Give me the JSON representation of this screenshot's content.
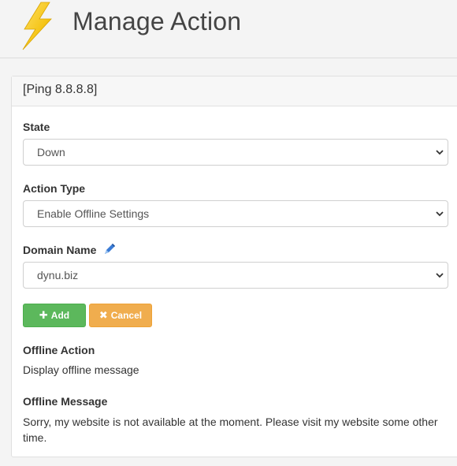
{
  "header": {
    "title": "Manage Action",
    "logo_icon": "lightning-bolt-icon"
  },
  "panel": {
    "heading": "[Ping 8.8.8.8]"
  },
  "form": {
    "state": {
      "label": "State",
      "value": "Down"
    },
    "action_type": {
      "label": "Action Type",
      "value": "Enable Offline Settings"
    },
    "domain_name": {
      "label": "Domain Name",
      "value": "dynu.biz",
      "edit_icon": "pencil-icon"
    }
  },
  "buttons": {
    "add_label": "Add",
    "add_icon": "plus-icon",
    "cancel_label": "Cancel",
    "cancel_icon": "times-icon"
  },
  "offline_action": {
    "label": "Offline Action",
    "value": "Display offline message"
  },
  "offline_message": {
    "label": "Offline Message",
    "value": "Sorry, my website is not available at the moment. Please visit my website some other time."
  },
  "colors": {
    "add_button": "#5cb85c",
    "cancel_button": "#f0ad4e",
    "logo_bolt": "#f5c518"
  }
}
